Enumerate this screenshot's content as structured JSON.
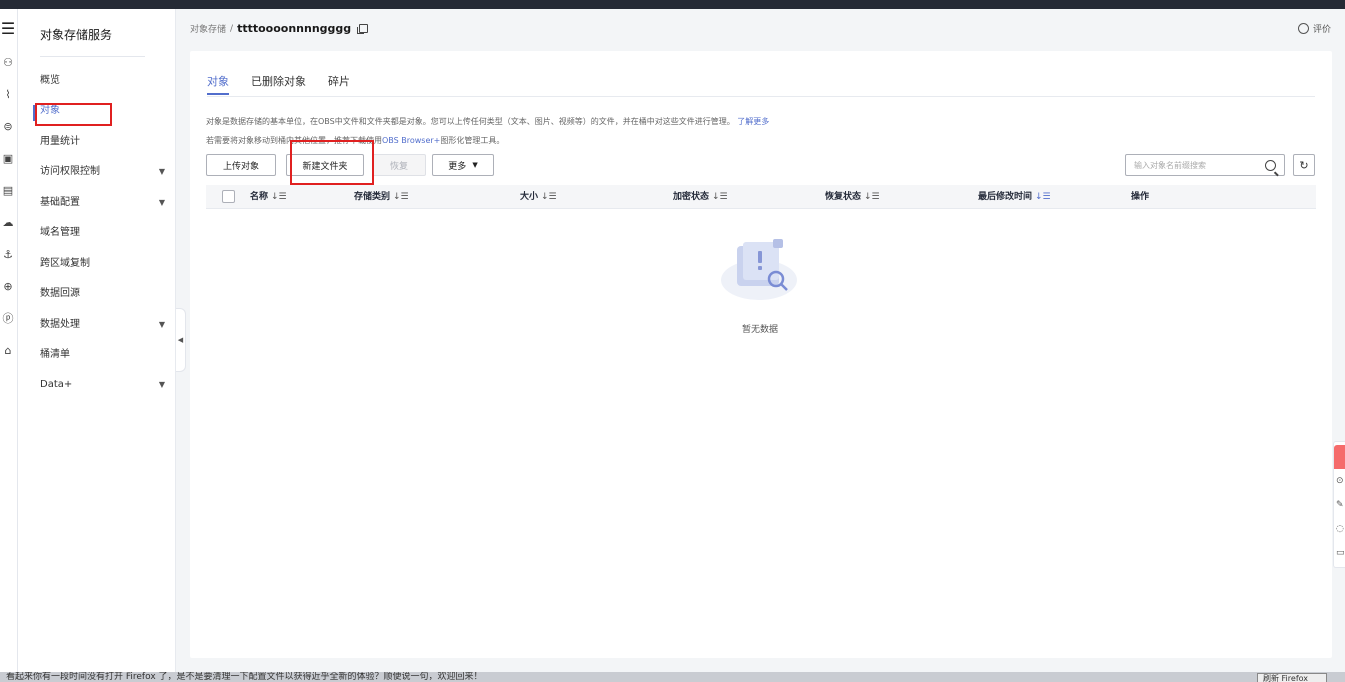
{
  "sidebar": {
    "service_title": "对象存储服务",
    "items": [
      {
        "label": "概览"
      },
      {
        "label": "对象"
      },
      {
        "label": "用量统计"
      },
      {
        "label": "访问权限控制"
      },
      {
        "label": "基础配置"
      },
      {
        "label": "域名管理"
      },
      {
        "label": "跨区域复制"
      },
      {
        "label": "数据回源"
      },
      {
        "label": "数据处理"
      },
      {
        "label": "桶清单"
      },
      {
        "label": "Data+"
      }
    ]
  },
  "breadcrumb": {
    "root": "对象存储",
    "separator": "/",
    "bucket": "ttttoooonnnngggg"
  },
  "header": {
    "rate_label": "评价"
  },
  "tabs": [
    {
      "label": "对象"
    },
    {
      "label": "已删除对象"
    },
    {
      "label": "碎片"
    }
  ],
  "description": {
    "line1": "对象是数据存储的基本单位，在OBS中文件和文件夹都是对象。您可以上传任何类型（文本、图片、视频等）的文件，并在桶中对这些文件进行管理。",
    "learn_more": "了解更多",
    "line2_prefix": "若需要将对象移动到桶内其他位置，推荐下载使用",
    "line2_link": "OBS Browser+",
    "line2_suffix": "图形化管理工具。"
  },
  "toolbar": {
    "upload": "上传对象",
    "new_folder": "新建文件夹",
    "restore": "恢复",
    "more": "更多"
  },
  "search": {
    "placeholder": "输入对象名前缀搜索"
  },
  "table": {
    "columns": [
      "名称",
      "存储类别",
      "大小",
      "加密状态",
      "恢复状态",
      "最后修改时间",
      "操作"
    ],
    "empty_text": "暂无数据"
  },
  "statusbar": {
    "text": "看起来你有一段时间没有打开 Firefox 了，是不是要清理一下配置文件以获得近乎全新的体验？顺便说一句，欢迎回来！",
    "button": "刷新 Firefox"
  },
  "colors": {
    "accent": "#526ecc",
    "highlight": "#e02020"
  }
}
